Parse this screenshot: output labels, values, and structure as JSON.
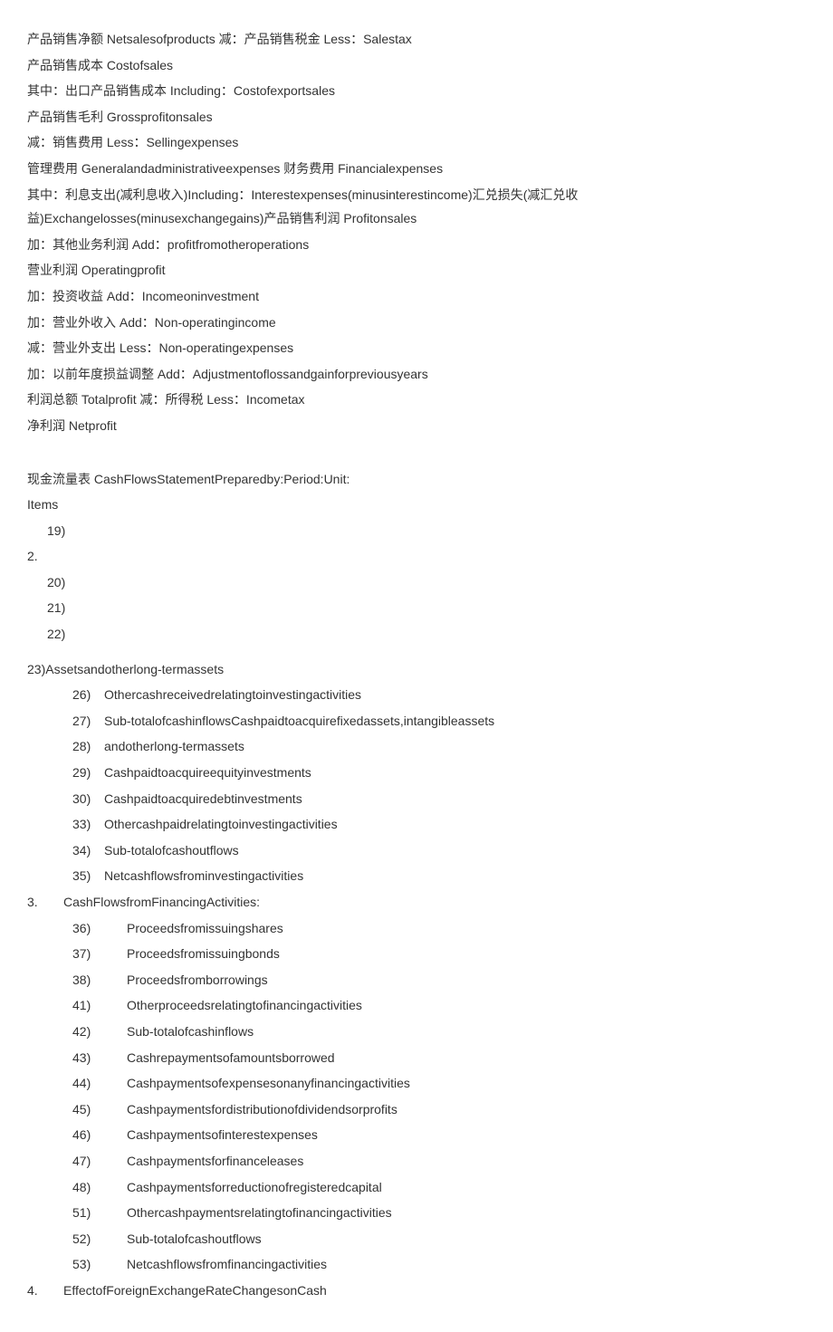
{
  "income_lines": [
    "产品销售净额 Netsalesofproducts 减：产品销售税金 Less：Salestax",
    "产品销售成本 Costofsales",
    "其中：出口产品销售成本 Including：Costofexportsales",
    "产品销售毛利 Grossprofitonsales",
    "减：销售费用 Less：Sellingexpenses",
    "管理费用 Generalandadministrativeexpenses 财务费用 Financialexpenses",
    "其中：利息支出(减利息收入)Including：Interestexpenses(minusinterestincome)汇兑损失(减汇兑收益)Exchangelosses(minusexchangegains)产品销售利润 Profitonsales",
    "加：其他业务利润 Add：profitfromotheroperations",
    "营业利润 Operatingprofit",
    "加：投资收益 Add：Incomeoninvestment",
    "加：营业外收入 Add：Non-operatingincome",
    "减：营业外支出 Less：Non-operatingexpenses",
    "加：以前年度损益调整 Add：Adjustmentoflossandgainforpreviousyears",
    "利润总额 Totalprofit 减：所得税 Less：Incometax",
    "净利润 Netprofit"
  ],
  "cfs_header": "现金流量表 CashFlowsStatementPreparedby:Period:Unit:",
  "items_label": "Items",
  "n19": "19)",
  "sec2": "2.",
  "nums_a": [
    "20)",
    "21)",
    "22)"
  ],
  "line23": "23)Assetsandotherlong-termassets",
  "list_b": [
    {
      "n": "26)",
      "t": "Othercashreceivedrelatingtoinvestingactivities"
    },
    {
      "n": "27)",
      "t": "Sub-totalofcashinflowsCashpaidtoacquirefixedassets,intangibleassets"
    },
    {
      "n": "28)",
      "t": "andotherlong-termassets"
    },
    {
      "n": "29)",
      "t": "Cashpaidtoacquireequityinvestments"
    },
    {
      "n": "30)",
      "t": "Cashpaidtoacquiredebtinvestments"
    },
    {
      "n": "33)",
      "t": "Othercashpaidrelatingtoinvestingactivities"
    },
    {
      "n": "34)",
      "t": "Sub-totalofcashoutflows"
    },
    {
      "n": "35)",
      "t": "Netcashflowsfrominvestingactivities"
    }
  ],
  "sec3_n": "3.",
  "sec3_t": "CashFlowsfromFinancingActivities:",
  "list_c": [
    {
      "n": "36)",
      "t": "Proceedsfromissuingshares"
    },
    {
      "n": "37)",
      "t": "Proceedsfromissuingbonds"
    },
    {
      "n": "38)",
      "t": "Proceedsfromborrowings"
    },
    {
      "n": "41)",
      "t": "Otherproceedsrelatingtofinancingactivities"
    },
    {
      "n": "42)",
      "t": "Sub-totalofcashinflows"
    },
    {
      "n": "43)",
      "t": "Cashrepaymentsofamountsborrowed"
    },
    {
      "n": "44)",
      "t": "Cashpaymentsofexpensesonanyfinancingactivities"
    },
    {
      "n": "45)",
      "t": "Cashpaymentsfordistributionofdividendsorprofits"
    },
    {
      "n": "46)",
      "t": "Cashpaymentsofinterestexpenses"
    },
    {
      "n": "47)",
      "t": "Cashpaymentsforfinanceleases"
    },
    {
      "n": "48)",
      "t": "Cashpaymentsforreductionofregisteredcapital"
    },
    {
      "n": "51)",
      "t": "Othercashpaymentsrelatingtofinancingactivities"
    },
    {
      "n": "52)",
      "t": "Sub-totalofcashoutflows"
    },
    {
      "n": "53)",
      "t": "Netcashflowsfromfinancingactivities"
    }
  ],
  "sec4_n": "4.",
  "sec4_t": "EffectofForeignExchangeRateChangesonCash"
}
